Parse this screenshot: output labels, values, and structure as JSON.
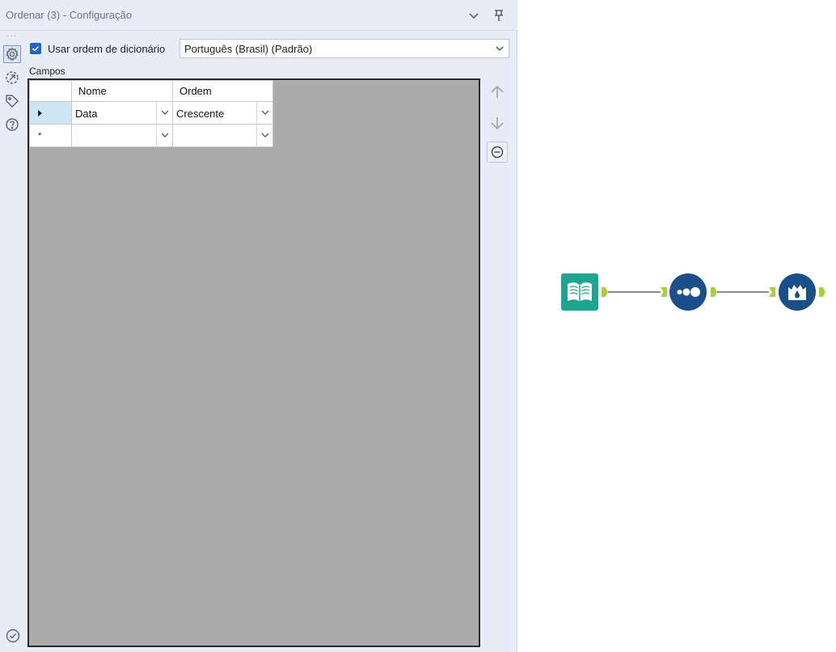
{
  "panel": {
    "title": "Ordenar (3) - Configuração",
    "sidebar_dots": "···"
  },
  "options": {
    "dictionary_order_label": "Usar ordem de dicionário",
    "dictionary_order_checked": true,
    "language_value": "Português (Brasil) (Padrão)"
  },
  "fields": {
    "label": "Campos",
    "columns": {
      "name": "Nome",
      "order": "Ordem"
    },
    "rows": [
      {
        "name": "Data",
        "order": "Crescente"
      },
      {
        "name": "",
        "order": ""
      }
    ],
    "new_row_marker": "*"
  },
  "colors": {
    "accent": "#1f63c4",
    "grid_bg": "#ababab",
    "input_node": "#1ea58f",
    "prep_node": "#1b4f8a",
    "anchor": "#a9cf3b"
  },
  "canvas": {
    "nodes": [
      {
        "name": "input-data",
        "icon": "book-icon"
      },
      {
        "name": "sort",
        "icon": "sort-dots-icon"
      },
      {
        "name": "output",
        "icon": "crown-drop-icon"
      }
    ]
  }
}
